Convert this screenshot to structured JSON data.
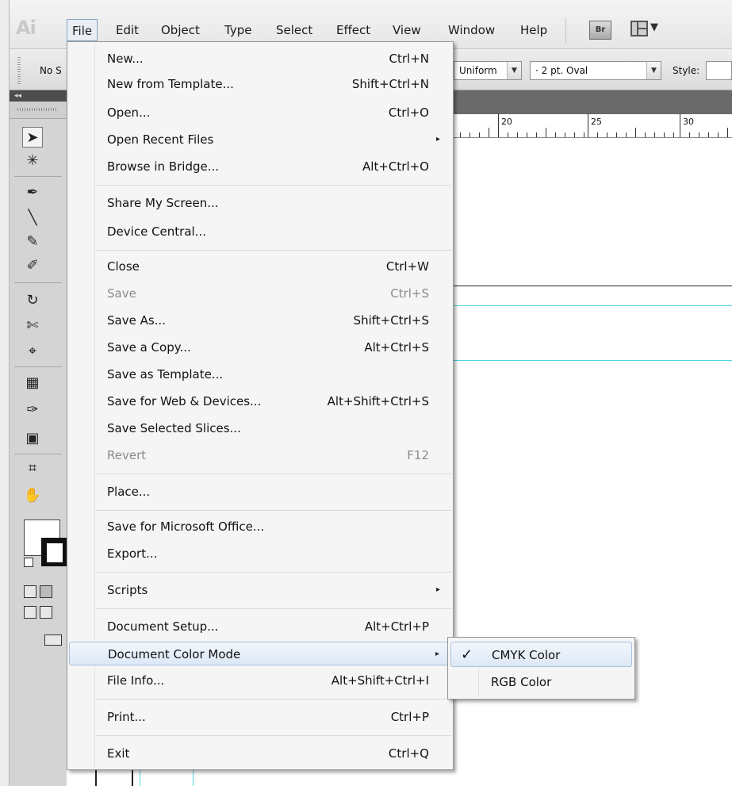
{
  "app": {
    "logo_text": "Ai"
  },
  "menubar": {
    "items": [
      "File",
      "Edit",
      "Object",
      "Type",
      "Select",
      "Effect",
      "View",
      "Window",
      "Help"
    ],
    "bridge_label": "Br",
    "workspace_icon": "workspace-switcher-icon",
    "workspace_arrow": "▼"
  },
  "control_bar": {
    "no_selection": "No S",
    "stroke_profile": "Uniform",
    "brush": "·  2 pt. Oval",
    "style_label": "Style:"
  },
  "ruler": {
    "labels": [
      "20",
      "25",
      "30"
    ]
  },
  "file_menu": {
    "items": [
      {
        "label": "New...",
        "shortcut": "Ctrl+N"
      },
      {
        "label": "New from Template...",
        "shortcut": "Shift+Ctrl+N"
      },
      {
        "label": "Open...",
        "shortcut": "Ctrl+O"
      },
      {
        "label": "Open Recent Files",
        "submenu": "▸"
      },
      {
        "label": "Browse in Bridge...",
        "shortcut": "Alt+Ctrl+O"
      },
      {
        "label": "Share My Screen..."
      },
      {
        "label": "Device Central..."
      },
      {
        "label": "Close",
        "shortcut": "Ctrl+W"
      },
      {
        "label": "Save",
        "shortcut": "Ctrl+S",
        "disabled": true
      },
      {
        "label": "Save As...",
        "shortcut": "Shift+Ctrl+S"
      },
      {
        "label": "Save a Copy...",
        "shortcut": "Alt+Ctrl+S"
      },
      {
        "label": "Save as Template..."
      },
      {
        "label": "Save for Web & Devices...",
        "shortcut": "Alt+Shift+Ctrl+S"
      },
      {
        "label": "Save Selected Slices..."
      },
      {
        "label": "Revert",
        "shortcut": "F12",
        "disabled": true
      },
      {
        "label": "Place..."
      },
      {
        "label": "Save for Microsoft Office..."
      },
      {
        "label": "Export..."
      },
      {
        "label": "Scripts",
        "submenu": "▸"
      },
      {
        "label": "Document Setup...",
        "shortcut": "Alt+Ctrl+P"
      },
      {
        "label": "Document Color Mode",
        "submenu": "▸",
        "highlighted": true
      },
      {
        "label": "File Info...",
        "shortcut": "Alt+Shift+Ctrl+I"
      },
      {
        "label": "Print...",
        "shortcut": "Ctrl+P"
      },
      {
        "label": "Exit",
        "shortcut": "Ctrl+Q"
      }
    ]
  },
  "color_mode_submenu": {
    "items": [
      {
        "label": "CMYK Color",
        "checked": true,
        "check_glyph": "✓"
      },
      {
        "label": "RGB Color",
        "checked": false
      }
    ]
  },
  "colors": {
    "menu_bg": "#f5f5f5",
    "highlight": "#dde8f6",
    "guide": "#4cd4e0",
    "tools_panel": "#d4d4d4"
  }
}
